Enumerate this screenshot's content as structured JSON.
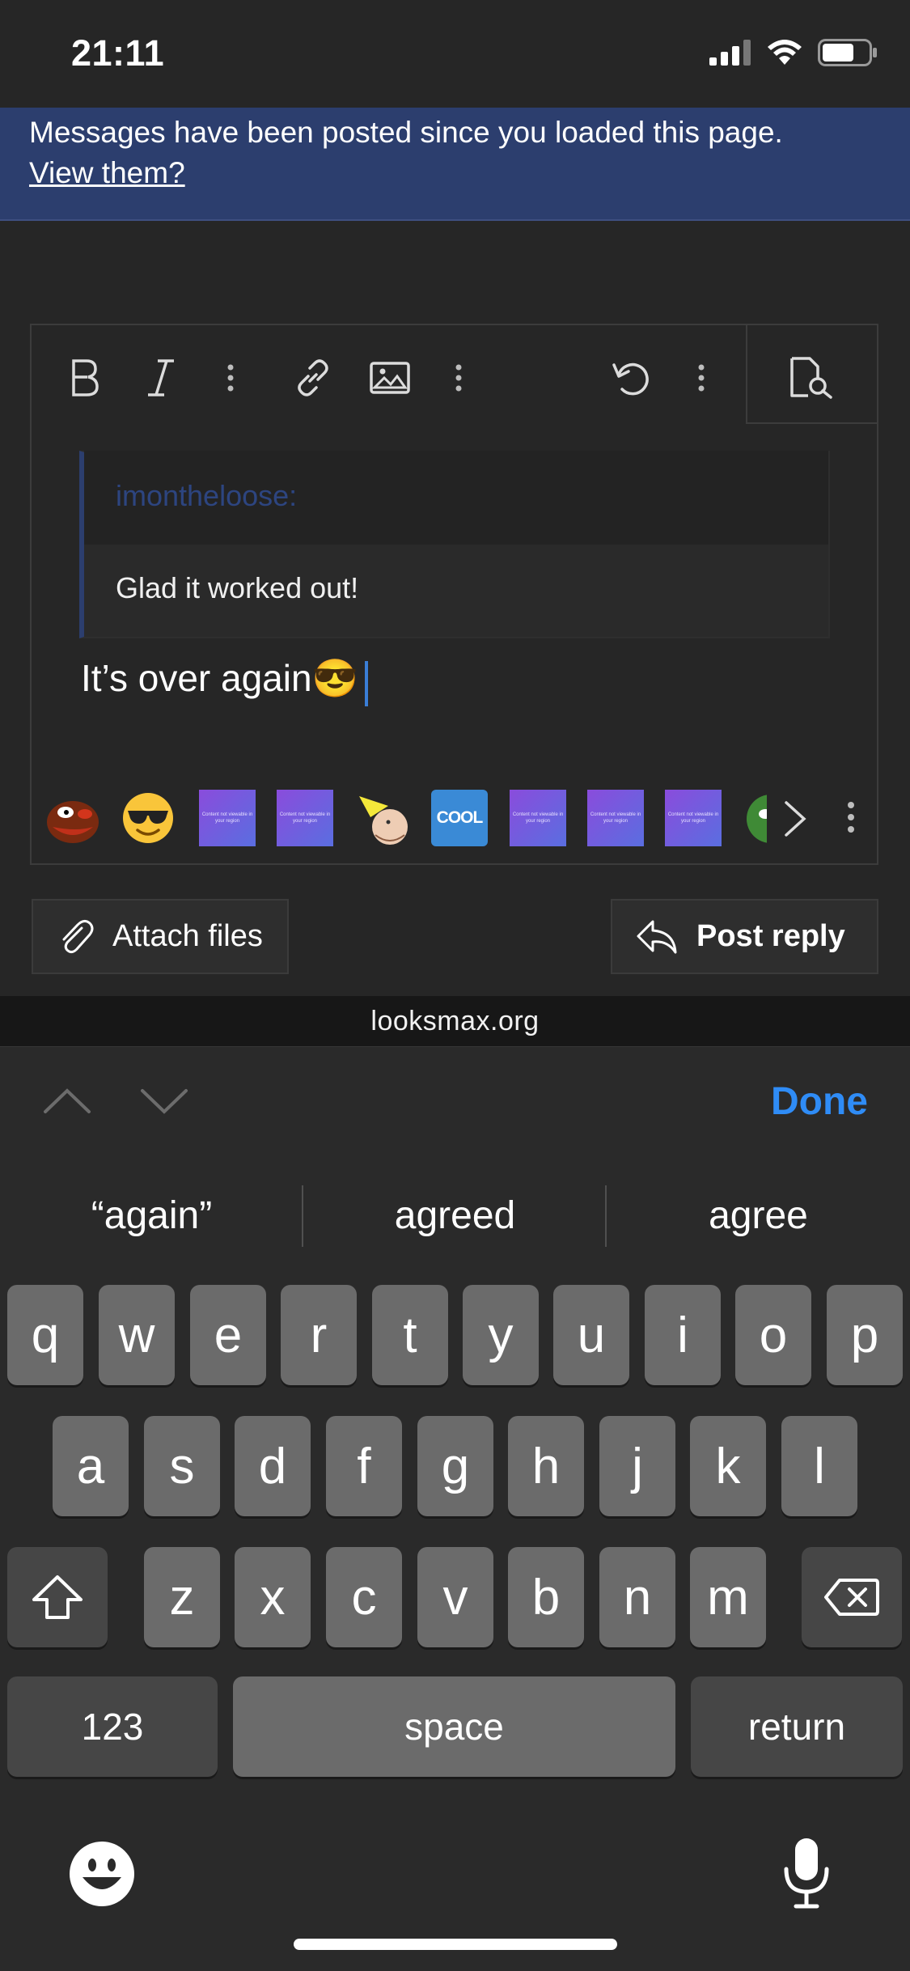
{
  "status_bar": {
    "time": "21:11"
  },
  "banner": {
    "message": "Messages have been posted since you loaded this page.",
    "link": "View them?"
  },
  "editor": {
    "quote_author": "imontheloose:",
    "quote_text": "Glad it worked out!",
    "reply_text": "It’s over again😎"
  },
  "smilies": [
    {
      "icon": "pepe-icon"
    },
    {
      "icon": "sunglasses-smile-icon"
    },
    {
      "icon": "blocked-content-icon",
      "text": "Content not viewable in your region"
    },
    {
      "icon": "blocked-content-icon",
      "text": "Content not viewable in your region"
    },
    {
      "icon": "gnome-face-icon"
    },
    {
      "icon": "cool-sticker-icon",
      "text": "COOL"
    },
    {
      "icon": "blocked-content-icon",
      "text": "Content not viewable in your region"
    },
    {
      "icon": "blocked-content-icon",
      "text": "Content not viewable in your region"
    },
    {
      "icon": "blocked-content-icon",
      "text": "Content not viewable in your region"
    },
    {
      "icon": "pepe-green-icon"
    }
  ],
  "buttons": {
    "attach": "Attach files",
    "post": "Post reply"
  },
  "url": "looksmax.org",
  "accessory": {
    "done": "Done"
  },
  "keyboard": {
    "suggestions": [
      "“again”",
      "agreed",
      "agree"
    ],
    "row1": [
      "q",
      "w",
      "e",
      "r",
      "t",
      "y",
      "u",
      "i",
      "o",
      "p"
    ],
    "row2": [
      "a",
      "s",
      "d",
      "f",
      "g",
      "h",
      "j",
      "k",
      "l"
    ],
    "row3": [
      "z",
      "x",
      "c",
      "v",
      "b",
      "n",
      "m"
    ],
    "numbers_label": "123",
    "space_label": "space",
    "return_label": "return"
  },
  "colors": {
    "banner": "#2c3e6e",
    "accent_blue": "#2f8cf6",
    "quote_author": "#2d4580",
    "caret": "#3a7ed6"
  }
}
